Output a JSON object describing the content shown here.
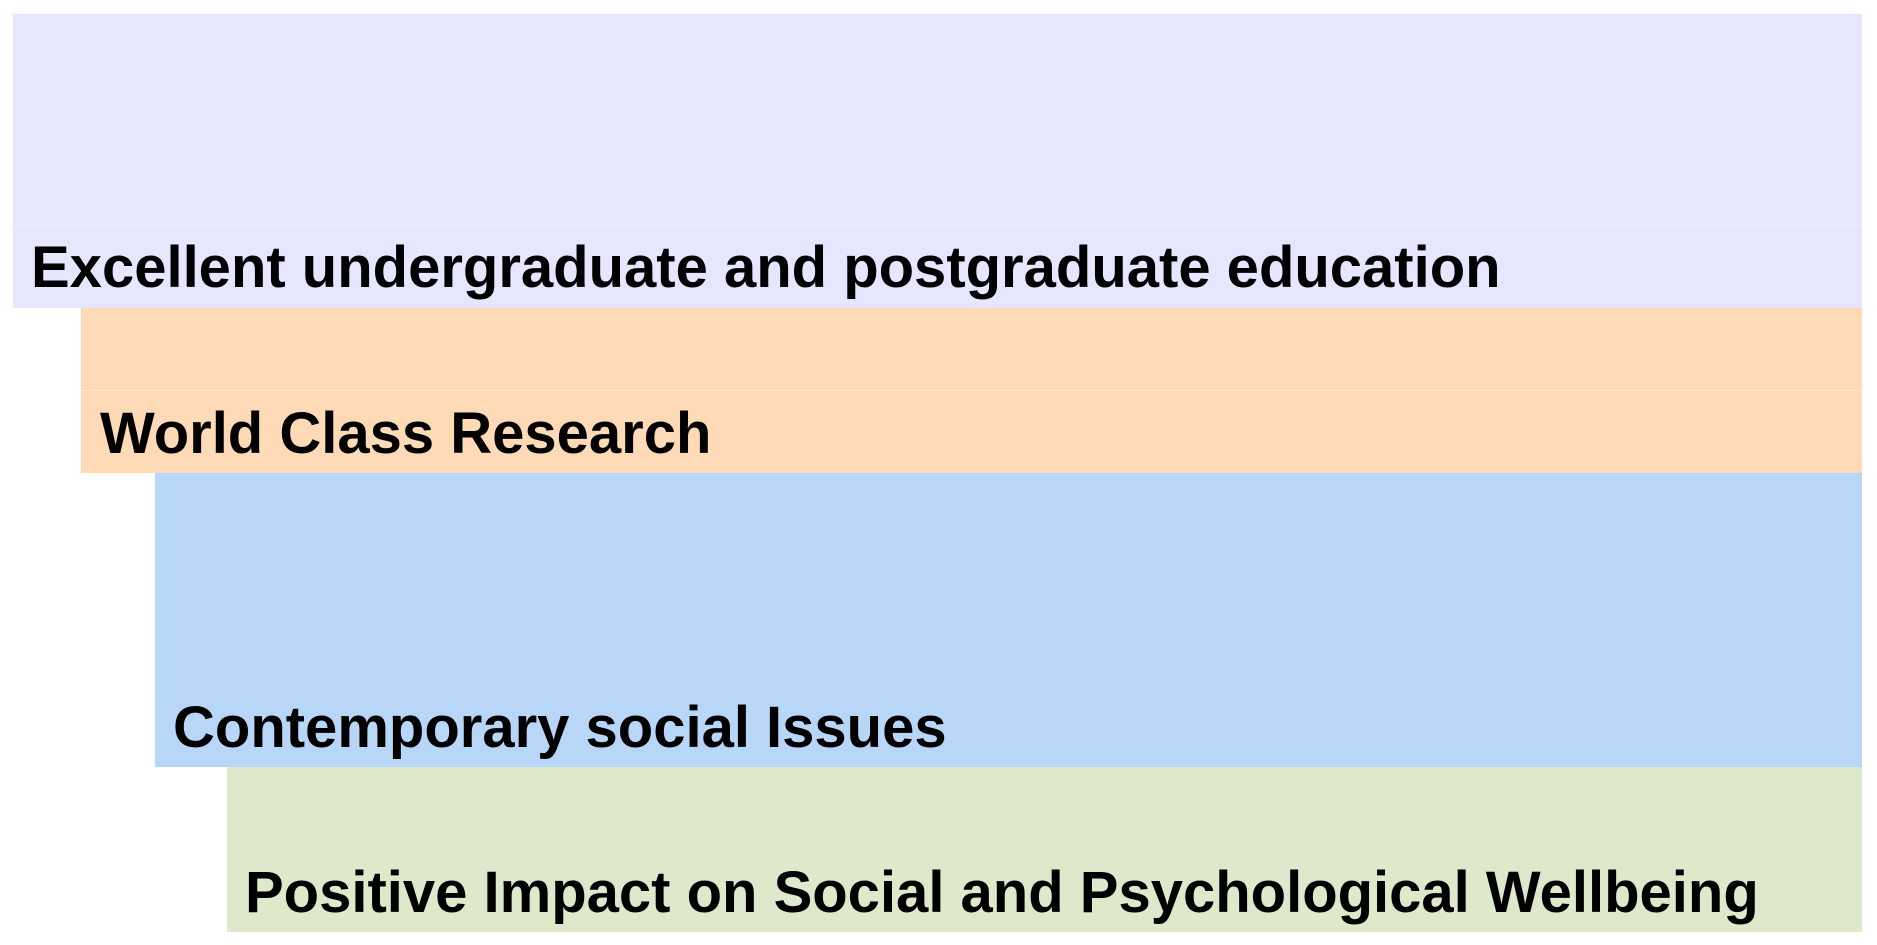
{
  "levels": [
    {
      "label": "Excellent undergraduate and postgraduate education",
      "color": "#e6e6fe"
    },
    {
      "label": "World Class Research",
      "color": "#fedab6"
    },
    {
      "label": "Contemporary social Issues",
      "color": "#b8d6f8"
    },
    {
      "label": "Positive Impact on Social and Psychological Wellbeing",
      "color": "#dee8cb"
    }
  ]
}
